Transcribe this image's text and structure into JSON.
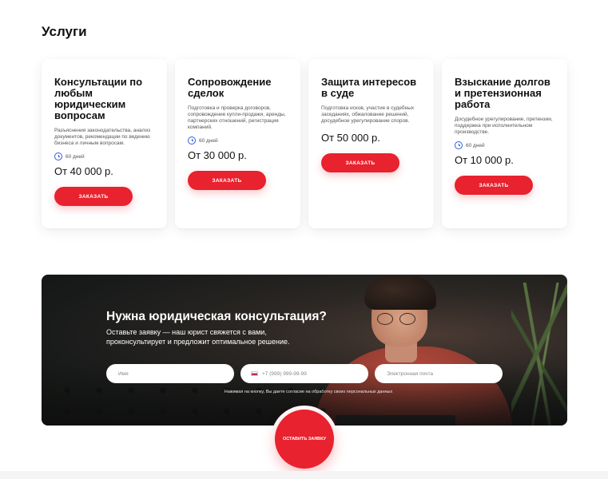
{
  "services": {
    "title": "Услуги",
    "cards": [
      {
        "title": "Консультации по любым юридическим вопросам",
        "description": "Разъяснения законодательства, анализ документов, рекомендации по ведению бизнеса и личным вопросам.",
        "duration": "60 дней",
        "price": "От 40 000 р.",
        "button": "ЗАКАЗАТЬ"
      },
      {
        "title": "Сопровождение сделок",
        "description": "Подготовка и проверка договоров, сопровождение купли-продажи, аренды, партнерских отношений, регистрация компаний.",
        "duration": "60 дней",
        "price": "От 30 000 р.",
        "button": "ЗАКАЗАТЬ"
      },
      {
        "title": "Защита интересов в суде",
        "description": "Подготовка исков, участие в судебных заседаниях, обжалование решений, досудебное урегулирование споров.",
        "duration": "",
        "price": "От 50 000 р.",
        "button": "ЗАКАЗАТЬ"
      },
      {
        "title": "Взыскание долгов и претензионная работа",
        "description": "Досудебное урегулирование, претензии, поддержка при исполнительном производстве.",
        "duration": "60 дней",
        "price": "От 10 000 р.",
        "button": "ЗАКАЗАТЬ"
      }
    ]
  },
  "consult": {
    "title": "Нужна юридическая консультация?",
    "subtitle": "Оставьте заявку — наш юрист свяжется с вами, проконсультирует и предложит оптимальное решение.",
    "name_placeholder": "Имя",
    "phone_placeholder": "+7 (999) 999-99-99",
    "email_placeholder": "Электронная почта",
    "consent": "Нажимая на кнопку, Вы даете согласие на обработку своих персональных данных",
    "submit": "ОСТАВИТЬ ЗАЯВКУ"
  },
  "colors": {
    "accent": "#e8222e",
    "icon": "#2c5ed8"
  },
  "icons": {
    "clock": "clock-icon",
    "flag": "flag-ru-icon"
  }
}
